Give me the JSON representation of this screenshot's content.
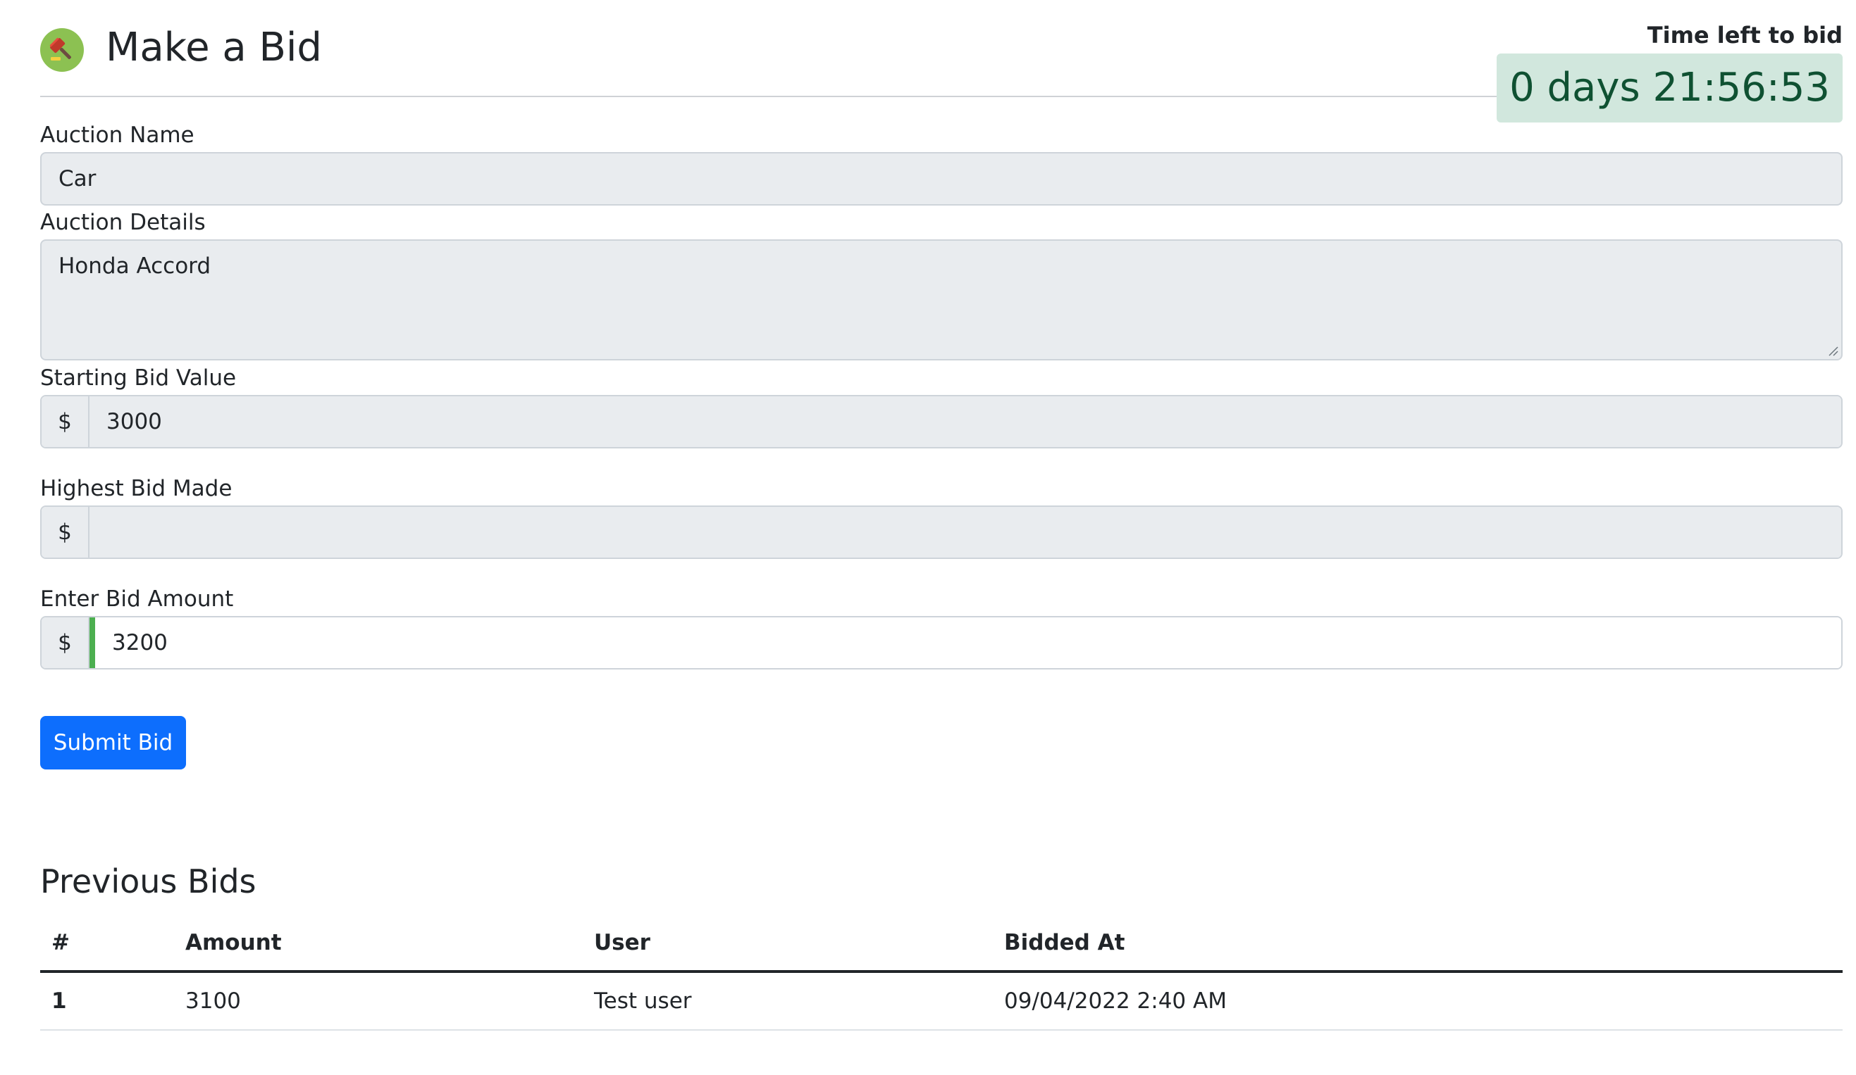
{
  "header": {
    "title": "Make a Bid",
    "logo_icon": "gavel-icon",
    "timer_label": "Time left to bid",
    "timer_value": "0 days 21:56:53"
  },
  "form": {
    "auction_name": {
      "label": "Auction Name",
      "value": "Car"
    },
    "auction_details": {
      "label": "Auction Details",
      "value": "Honda Accord"
    },
    "starting_bid": {
      "label": "Starting Bid Value",
      "prefix": "$",
      "value": "3000"
    },
    "highest_bid": {
      "label": "Highest Bid Made",
      "prefix": "$",
      "value": ""
    },
    "bid_amount": {
      "label": "Enter Bid Amount",
      "prefix": "$",
      "value": "3200"
    },
    "submit_label": "Submit Bid"
  },
  "previous_bids": {
    "title": "Previous Bids",
    "columns": [
      "#",
      "Amount",
      "User",
      "Bidded At"
    ],
    "rows": [
      {
        "num": "1",
        "amount": "3100",
        "user": "Test user",
        "bidded_at": "09/04/2022 2:40 AM"
      }
    ]
  },
  "colors": {
    "primary": "#0d6efd",
    "timer_bg": "#d1e7dd",
    "timer_text": "#0f5132",
    "valid_accent": "#4caf50",
    "readonly_bg": "#e9ecef"
  }
}
